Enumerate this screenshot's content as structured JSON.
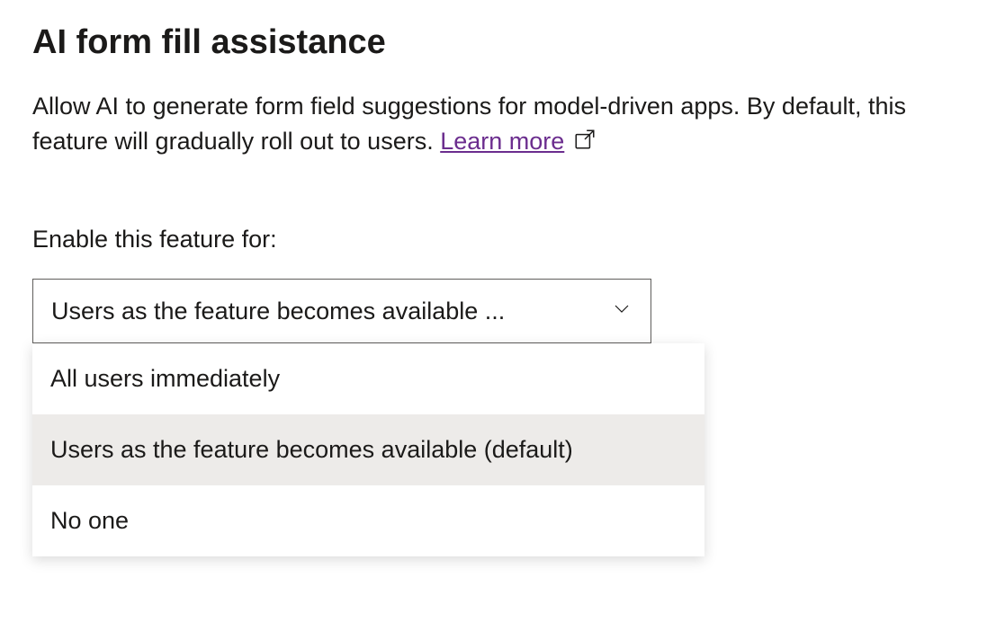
{
  "heading": "AI form fill assistance",
  "description_part1": "Allow AI to generate form field suggestions for model-driven apps. By default, this feature will gradually roll out to users. ",
  "learn_more_label": "Learn more",
  "field_label": "Enable this feature for:",
  "select": {
    "display_value": "Users as the feature becomes available ...",
    "options": [
      "All users immediately",
      "Users as the feature becomes available (default)",
      "No one"
    ],
    "selected_index": 1
  }
}
